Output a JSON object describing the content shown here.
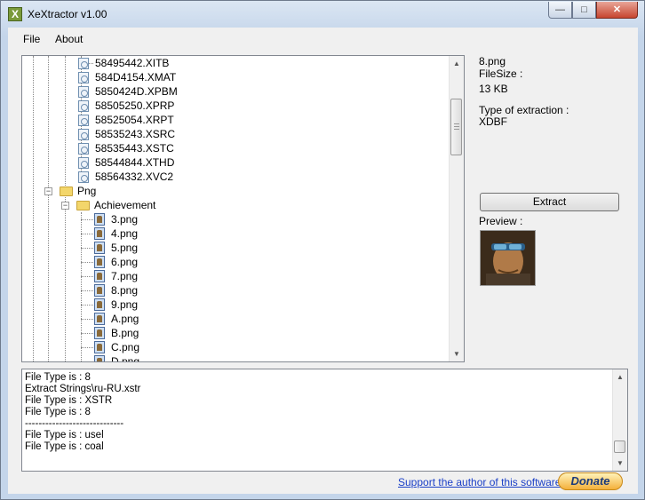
{
  "window": {
    "title": "XeXtractor v1.00",
    "app_icon_glyph": "X",
    "minimize_glyph": "—",
    "maximize_glyph": "□",
    "close_glyph": "✕"
  },
  "menu": {
    "file": "File",
    "about": "About"
  },
  "tree": {
    "items": [
      "58495442.XITB",
      "584D4154.XMAT",
      "5850424D.XPBM",
      "58505250.XPRP",
      "58525054.XRPT",
      "58535243.XSRC",
      "58535443.XSTC",
      "58544844.XTHD",
      "58564332.XVC2"
    ],
    "folder_png": "Png",
    "folder_png_expander": "−",
    "folder_achievement": "Achievement",
    "folder_achievement_expander": "−",
    "png_items": [
      "3.png",
      "4.png",
      "5.png",
      "6.png",
      "7.png",
      "8.png",
      "9.png",
      "A.png",
      "B.png",
      "C.png",
      "D.png"
    ],
    "scroll_up": "▲",
    "scroll_down": "▼"
  },
  "info": {
    "filename": "8.png",
    "filesize_label": "FileSize :",
    "filesize_value": "13 KB",
    "type_label": "Type of extraction :",
    "type_value": "XDBF",
    "extract_button": "Extract",
    "preview_label": "Preview :"
  },
  "log": {
    "lines": [
      "File Type is : 8",
      "Extract Strings\\ru-RU.xstr",
      "File Type is : XSTR",
      "File Type is : 8",
      "-----------------------------",
      "File Type is : usel",
      "File Type is : coal"
    ],
    "scroll_up": "▲",
    "scroll_down": "▼"
  },
  "footer": {
    "support_link": "Support the author of this software :",
    "donate_button": "Donate"
  }
}
